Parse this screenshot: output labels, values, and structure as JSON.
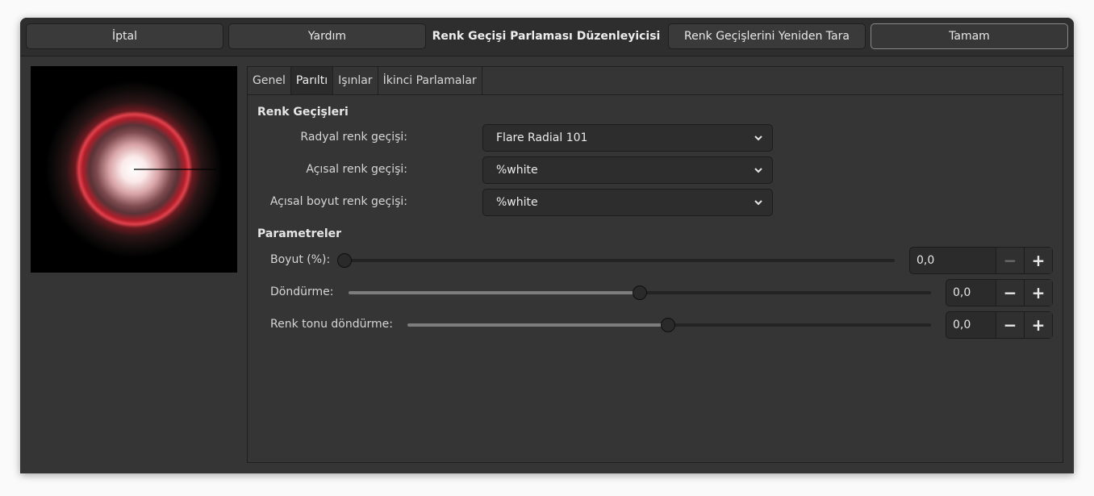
{
  "header": {
    "cancel_label": "İptal",
    "help_label": "Yardım",
    "title": "Renk Geçişi Parlaması Düzenleyicisi",
    "rescan_label": "Renk Geçişlerini Yeniden Tara",
    "ok_label": "Tamam"
  },
  "tabs": [
    {
      "label": "Genel"
    },
    {
      "label": "Parıltı"
    },
    {
      "label": "Işınlar"
    },
    {
      "label": "İkinci Parlamalar"
    }
  ],
  "gradients": {
    "heading": "Renk Geçişleri",
    "radial": {
      "label": "Radyal renk geçişi:",
      "value": "Flare Radial 101"
    },
    "angular": {
      "label": "Açısal renk geçişi:",
      "value": "%white"
    },
    "angular_size": {
      "label": "Açısal boyut renk geçişi:",
      "value": "%white"
    }
  },
  "parameters": {
    "heading": "Parametreler",
    "size": {
      "label": "Boyut (%):",
      "value": "0,0",
      "fraction": 0.0
    },
    "rotation": {
      "label": "Döndürme:",
      "value": "0,0",
      "fraction": 0.5
    },
    "hue_rotation": {
      "label": "Renk tonu döndürme:",
      "value": "0,0",
      "fraction": 0.5
    }
  },
  "icons": {
    "chevron": "chevron-down-icon",
    "minus": "minus-icon",
    "plus": "plus-icon"
  }
}
